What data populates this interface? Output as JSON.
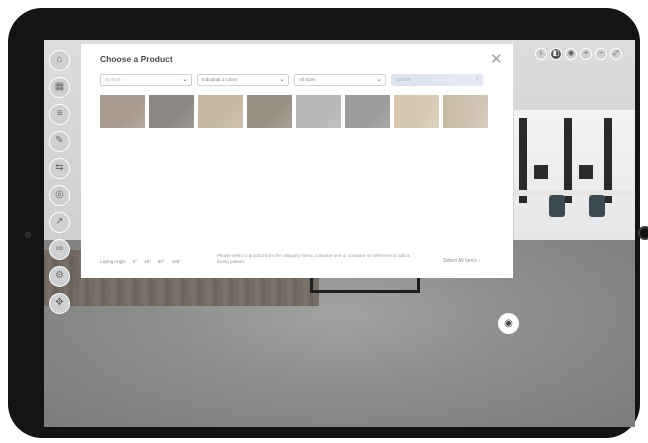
{
  "panel": {
    "title": "Choose a Product",
    "close_label": "✕",
    "filters": [
      {
        "value": "Surface",
        "placeholder": true
      },
      {
        "value": "Industrial 2 colors",
        "placeholder": false
      },
      {
        "value": "All sizes",
        "placeholder": false
      }
    ],
    "search": {
      "placeholder": "Search"
    },
    "swatches": [
      {
        "color": "#a89b8f"
      },
      {
        "color": "#8b8783"
      },
      {
        "color": "#c7b8a1"
      },
      {
        "color": "#9a8f84"
      },
      {
        "color": "#b8b7b5"
      },
      {
        "color": "#9b9b9b"
      },
      {
        "color": "#d5c7b0"
      },
      {
        "color": "#c2b29b"
      }
    ],
    "footer": {
      "laying_label": "Laying Angle",
      "angles": [
        "0°",
        "45°",
        "90°",
        "135°"
      ],
      "note": "Please select a product from the category menu, compare one or compare on reference to add a laying pattern.",
      "next_label": "Select All Items",
      "next_icon": "chevron-right-icon"
    }
  },
  "left_toolbar": {
    "icons": [
      "home-icon",
      "rooms-icon",
      "layers-icon",
      "brush-icon",
      "compare-icon",
      "camera-icon",
      "share-icon",
      "link-icon",
      "settings-icon",
      "fullscreen-icon"
    ]
  },
  "top_bar": {
    "icons": [
      "info-icon",
      "view-2d-icon",
      "view-3d-icon",
      "zoom-in-icon",
      "zoom-out-icon",
      "expand-icon"
    ]
  },
  "view_toggle": {
    "icon": "eye-icon"
  }
}
